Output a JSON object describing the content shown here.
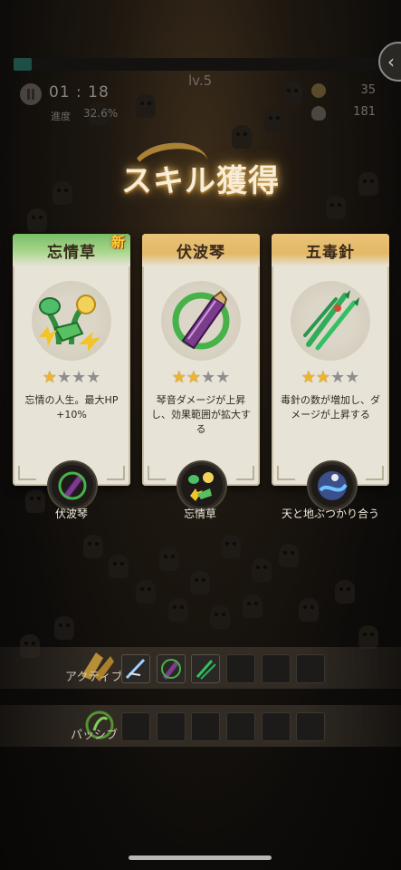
{
  "hud": {
    "timer": "01 : 18",
    "level": "lv.5",
    "progress_label": "進度",
    "progress_value": "32.6%",
    "coins": "35",
    "kills": "181"
  },
  "title": "スキル獲得",
  "cards": [
    {
      "name": "忘情草",
      "badge": "新",
      "stars_filled": 1,
      "stars_total": 4,
      "description": "忘情の人生。最大HP +10%",
      "combo_label": "伏波琴"
    },
    {
      "name": "伏波琴",
      "badge": "",
      "stars_filled": 2,
      "stars_total": 4,
      "description": "琴音ダメージが上昇し、効果範囲が拡大する",
      "combo_label": "忘情草"
    },
    {
      "name": "五毒針",
      "badge": "",
      "stars_filled": 2,
      "stars_total": 4,
      "description": "毒針の数が増加し、ダメージが上昇する",
      "combo_label": "天と地ぶつかり合う"
    }
  ],
  "skill_bars": {
    "active_label": "アクティブ",
    "passive_label": "パッシブ",
    "active_filled": 3,
    "slots": 6
  },
  "colors": {
    "accent_gold": "#e3b866",
    "accent_green": "#79bd66",
    "star_gold": "#f0b429"
  }
}
